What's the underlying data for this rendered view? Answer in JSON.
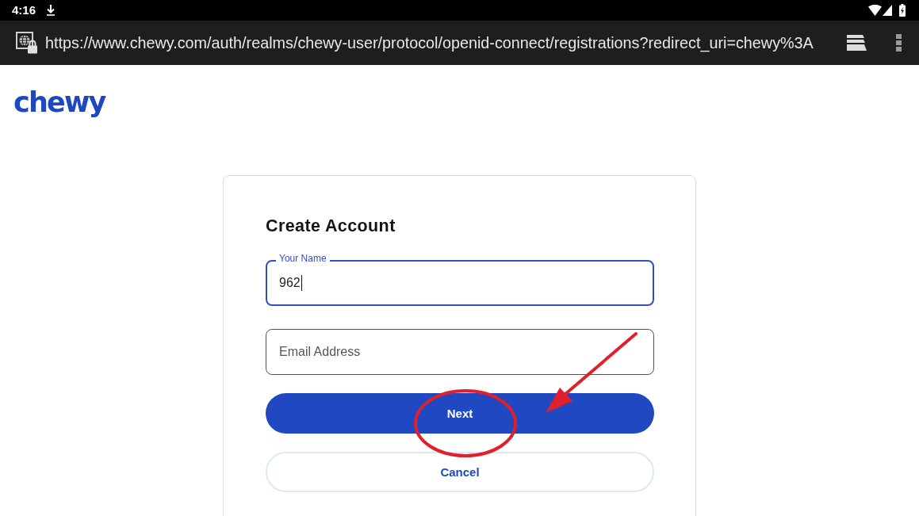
{
  "status_bar": {
    "time": "4:16"
  },
  "browser": {
    "url": "https://www.chewy.com/auth/realms/chewy-user/protocol/openid-connect/registrations?redirect_uri=chewy%3A"
  },
  "logo": "chewy",
  "form": {
    "title": "Create Account",
    "fields": [
      {
        "label": "Your Name",
        "value": "962",
        "focused": true
      },
      {
        "placeholder": "Email Address",
        "focused": false
      }
    ],
    "buttons": [
      {
        "label": "Next",
        "kind": "primary"
      },
      {
        "label": "Cancel",
        "kind": "secondary"
      }
    ]
  }
}
